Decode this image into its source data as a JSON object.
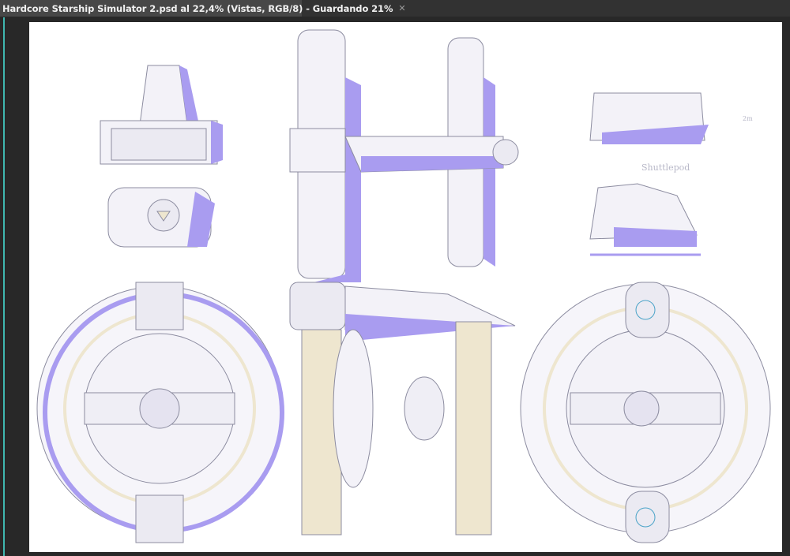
{
  "document_tab": {
    "title": "Hardcore Starship Simulator 2.psd al 22,4% (Vistas, RGB/8) - Guardando 21%",
    "close_icon": "close-icon"
  },
  "canvas": {
    "sketch_labels": {
      "shuttlepod": "Shuttlepod",
      "scale_2m": "2m"
    }
  },
  "colors": {
    "ink": "#8c8ca0",
    "shadow": "#a99cf0",
    "accent_yellow": "#eee6cf",
    "guide": "#3fb7b0"
  }
}
